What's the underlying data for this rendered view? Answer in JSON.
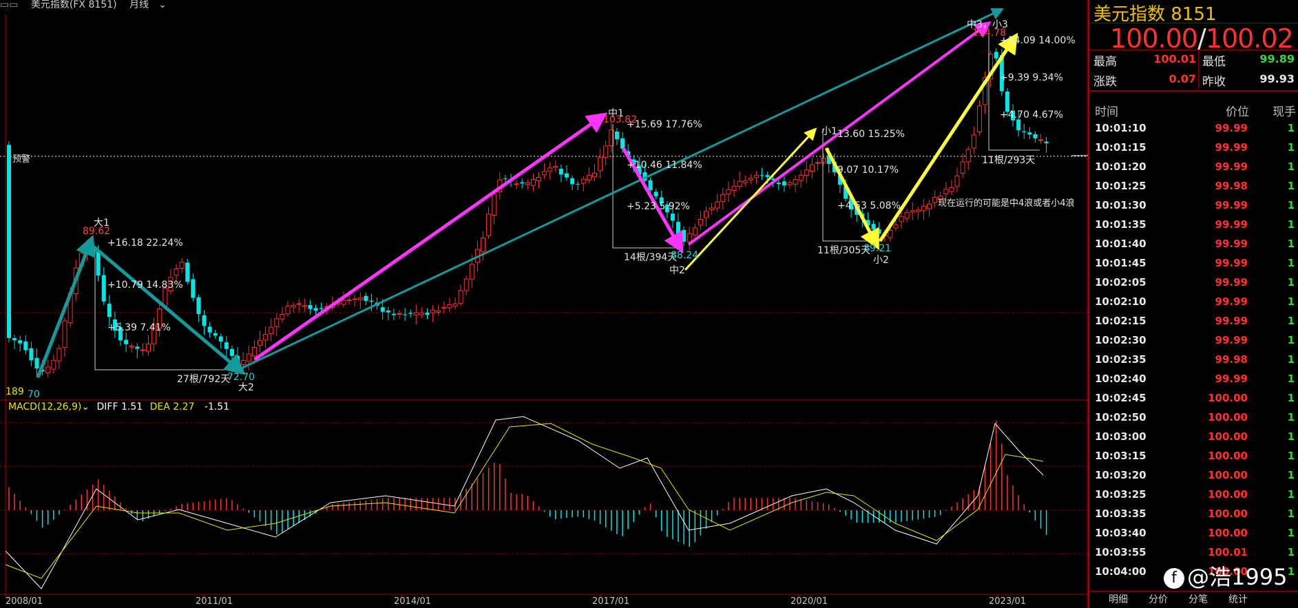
{
  "topbar": {
    "symbol": "美元指数(FX 8151)",
    "period": "月线"
  },
  "warning_label": "预警",
  "macd_label": {
    "params": "MACD(12,26,9)",
    "diff": "DIFF 1.51",
    "dea": "DEA 2.27",
    "macd": "-1.51"
  },
  "x_axis": [
    "2008/01",
    "2011/01",
    "2014/01",
    "2017/01",
    "2020/01",
    "2023/01"
  ],
  "annotations": {
    "da1_name": "大1",
    "da1_price": "89.62",
    "da1_l1": "+16.18  22.24%",
    "da1_l2": "+10.79  14.83%",
    "da1_l3": "+5.39  7.41%",
    "da1_bars": "27根/792天",
    "da2_price": "72.70",
    "da2_name": "大2",
    "left_low_price": "70",
    "left_low_count": "189",
    "zhong1_name": "中1",
    "zhong1_price": "103.82",
    "z1_l1": "+15.69  17.76%",
    "z1_l2": "+10.46  11.84%",
    "z1_l3": "+5.23  5.92%",
    "z1_bars": "14根/394天",
    "z2_price": "88.24",
    "zhong2_name": "中2",
    "xiao1_name": "小1",
    "x1_l1": "13.60  15.25%",
    "x1_l2": "9.07  10.17%",
    "x1_l3": "+4.53  5.08%",
    "x1_bars": "11根/305天",
    "x2_price": "89.21",
    "xiao2_name": "小2",
    "top_name": "中3，小3",
    "top_price": "114.78",
    "t_l1": "+14.09  14.00%",
    "t_l2": "+9.39  9.34%",
    "t_l3": "+4.70  4.67%",
    "t_bars": "11根/293天",
    "note": "现在运行的可能是中4浪或者小4浪"
  },
  "panel": {
    "title": "美元指数  8151",
    "price_bid": "100.00",
    "price_sep": "/",
    "price_ask": "100.02",
    "high_label": "最高",
    "high_val": "100.01",
    "low_label": "最低",
    "low_val": "99.89",
    "chg_label": "涨跌",
    "chg_val": "0.07",
    "prev_label": "昨收",
    "prev_val": "99.93",
    "col_time": "时间",
    "col_price": "价位",
    "col_vol": "现手",
    "ticks": [
      {
        "t": "10:01:10",
        "p": "99.99",
        "v": "1"
      },
      {
        "t": "10:01:15",
        "p": "99.99",
        "v": "1"
      },
      {
        "t": "10:01:20",
        "p": "99.99",
        "v": "1"
      },
      {
        "t": "10:01:25",
        "p": "99.98",
        "v": "1"
      },
      {
        "t": "10:01:30",
        "p": "99.99",
        "v": "1"
      },
      {
        "t": "10:01:35",
        "p": "99.99",
        "v": "1"
      },
      {
        "t": "10:01:40",
        "p": "99.99",
        "v": "1"
      },
      {
        "t": "10:01:45",
        "p": "99.99",
        "v": "1"
      },
      {
        "t": "10:02:05",
        "p": "99.99",
        "v": "1"
      },
      {
        "t": "10:02:10",
        "p": "99.99",
        "v": "1"
      },
      {
        "t": "10:02:15",
        "p": "99.99",
        "v": "1"
      },
      {
        "t": "10:02:30",
        "p": "99.99",
        "v": "1"
      },
      {
        "t": "10:02:35",
        "p": "99.98",
        "v": "1"
      },
      {
        "t": "10:02:40",
        "p": "99.99",
        "v": "1"
      },
      {
        "t": "10:02:45",
        "p": "100.00",
        "v": "1"
      },
      {
        "t": "10:02:50",
        "p": "100.00",
        "v": "1"
      },
      {
        "t": "10:03:00",
        "p": "100.00",
        "v": "1"
      },
      {
        "t": "10:03:15",
        "p": "100.00",
        "v": "1"
      },
      {
        "t": "10:03:20",
        "p": "100.00",
        "v": "1"
      },
      {
        "t": "10:03:25",
        "p": "100.00",
        "v": "1"
      },
      {
        "t": "10:03:35",
        "p": "100.00",
        "v": "1"
      },
      {
        "t": "10:03:40",
        "p": "100.00",
        "v": "1"
      },
      {
        "t": "10:03:55",
        "p": "100.01",
        "v": "1"
      },
      {
        "t": "10:04:00",
        "p": "100.00",
        "v": "1"
      }
    ],
    "tabs": [
      "明细",
      "分价",
      "分笔",
      "统计"
    ]
  },
  "watermark": "@浩1995",
  "colors": {
    "up": "#ff3030",
    "down": "#00e5e5",
    "green": "#3cd23c",
    "magenta": "#ff33ff",
    "teal": "#139a9a",
    "yellow": "#ffff33",
    "grid": "#8a0000"
  }
}
